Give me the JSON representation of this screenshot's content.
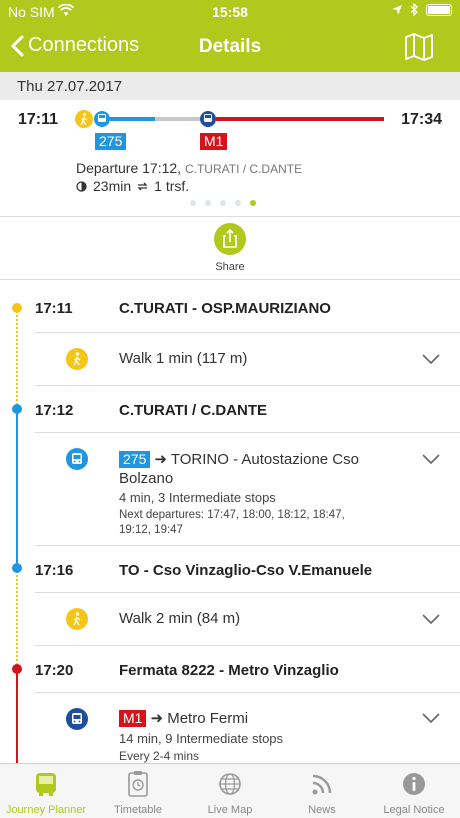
{
  "status": {
    "carrier": "No SIM",
    "time": "15:58"
  },
  "nav": {
    "back_label": "Connections",
    "title": "Details"
  },
  "summary": {
    "date": "Thu 27.07.2017",
    "start_time": "17:11",
    "end_time": "17:34",
    "lines": [
      "275",
      "M1"
    ],
    "departure_text": "Departure 17:12,",
    "departure_stop": "C.TURATI / C.DANTE",
    "duration": "23min",
    "transfers": "1 trsf."
  },
  "share_label": "Share",
  "timeline": {
    "stops": [
      {
        "time": "17:11",
        "name": "C.TURATI - OSP.MAURIZIANO"
      },
      {
        "time": "17:12",
        "name": "C.TURATI / C.DANTE"
      },
      {
        "time": "17:16",
        "name": "TO - Cso Vinzaglio-Cso V.Emanuele"
      },
      {
        "time": "17:20",
        "name": "Fermata 8222 - Metro Vinzaglio"
      }
    ],
    "legs": [
      {
        "type": "walk",
        "text": "Walk 1 min (117 m)"
      },
      {
        "type": "bus",
        "line": "275",
        "arrow": "➜",
        "destination": "TORINO - Autostazione Cso",
        "destination_cont": "Bolzano",
        "details": "4 min, 3 Intermediate stops",
        "next_departures": "Next departures: 17:47, 18:00, 18:12, 18:47,",
        "next_departures_cont": "19:12, 19:47"
      },
      {
        "type": "walk",
        "text": "Walk 2 min (84 m)"
      },
      {
        "type": "metro",
        "line": "M1",
        "arrow": "➜",
        "destination": "Metro Fermi",
        "details": "14 min, 9 Intermediate stops",
        "frequency": "Every 2-4 mins"
      }
    ]
  },
  "tabs": [
    {
      "label": "Journey Planner",
      "icon": "bus-tab-icon",
      "active": true
    },
    {
      "label": "Timetable",
      "icon": "timetable-icon",
      "active": false
    },
    {
      "label": "Live Map",
      "icon": "globe-icon",
      "active": false
    },
    {
      "label": "News",
      "icon": "rss-icon",
      "active": false
    },
    {
      "label": "Legal Notice",
      "icon": "info-icon",
      "active": false
    }
  ],
  "colors": {
    "accent": "#b1c81c",
    "bus": "#2196e0",
    "metro": "#d4141b",
    "walk": "#f5c518"
  }
}
